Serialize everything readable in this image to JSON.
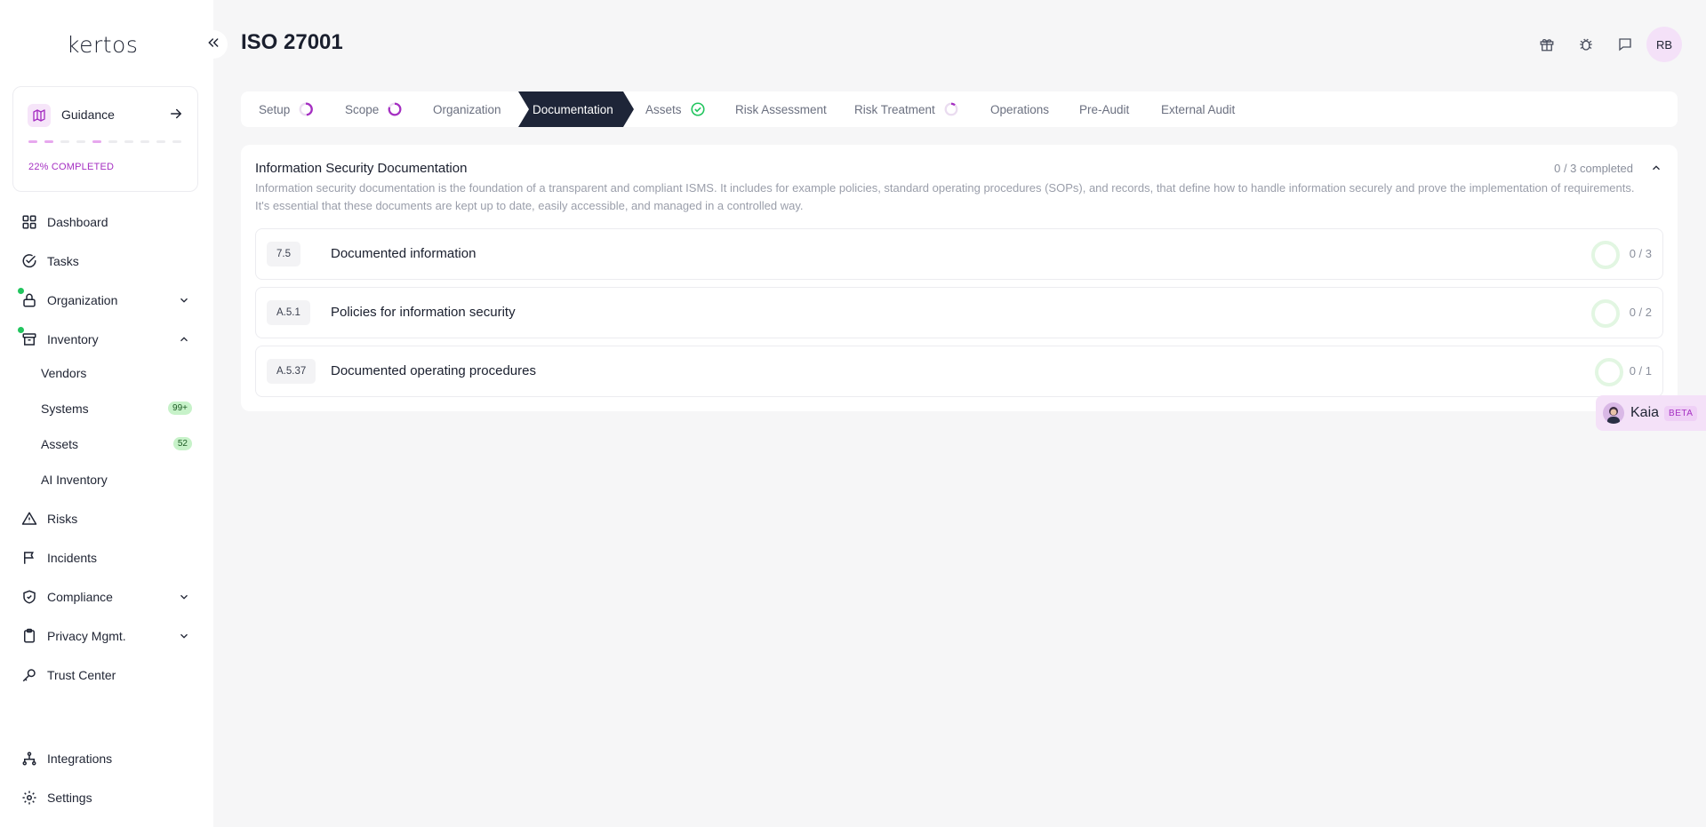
{
  "app": {
    "logo": "kertos",
    "collapse_icon": "double-chevron-left-icon"
  },
  "guidance": {
    "label": "Guidance",
    "progress_text": "22% COMPLETED",
    "progress_fraction": 0.22,
    "steps_total": 10,
    "steps_done": [
      0,
      1,
      4
    ]
  },
  "sidebar": {
    "items": [
      {
        "label": "Dashboard",
        "icon": "grid-icon"
      },
      {
        "label": "Tasks",
        "icon": "check-circle-icon"
      },
      {
        "label": "Organization",
        "icon": "lock-icon",
        "expand": "chevron-down-icon"
      },
      {
        "label": "Inventory",
        "icon": "archive-icon",
        "expand": "chevron-up-icon"
      },
      {
        "label": "Risks",
        "icon": "warning-icon"
      },
      {
        "label": "Incidents",
        "icon": "flag-icon"
      },
      {
        "label": "Compliance",
        "icon": "shield-check-icon",
        "expand": "chevron-down-icon"
      },
      {
        "label": "Privacy Mgmt.",
        "icon": "clipboard-icon",
        "expand": "chevron-down-icon"
      },
      {
        "label": "Trust Center",
        "icon": "key-icon"
      },
      {
        "label": "Integrations",
        "icon": "network-icon"
      },
      {
        "label": "Settings",
        "icon": "gear-icon"
      }
    ],
    "inventory_sub": [
      {
        "label": "Vendors"
      },
      {
        "label": "Systems",
        "badge": "99+"
      },
      {
        "label": "Assets",
        "badge": "52"
      },
      {
        "label": "AI Inventory"
      }
    ]
  },
  "header": {
    "title": "ISO 27001",
    "icons": [
      "gift-icon",
      "bug-icon",
      "chat-icon"
    ],
    "avatar": "RB"
  },
  "stepper": {
    "steps": [
      {
        "label": "Setup",
        "status": "in-progress"
      },
      {
        "label": "Scope",
        "status": "in-progress"
      },
      {
        "label": "Organization",
        "status": "none"
      },
      {
        "label": "Documentation",
        "status": "active"
      },
      {
        "label": "Assets",
        "status": "done"
      },
      {
        "label": "Risk Assessment",
        "status": "none"
      },
      {
        "label": "Risk Treatment",
        "status": "in-progress"
      },
      {
        "label": "Operations",
        "status": "none"
      },
      {
        "label": "Pre-Audit",
        "status": "none"
      },
      {
        "label": "External Audit",
        "status": "none"
      }
    ],
    "active_color": "#1e2538"
  },
  "section": {
    "title": "Information Security Documentation",
    "status": "0 / 3 completed",
    "description": "Information security documentation is the foundation of a transparent and compliant ISMS. It includes for example policies, standard operating procedures (SOPs), and records, that define how to handle information securely and prove the implementation of requirements. It's essential that these documents are kept up to date, easily accessible, and managed in a controlled way.",
    "requirements": [
      {
        "code": "7.5",
        "title": "Documented information",
        "count": "0 / 3"
      },
      {
        "code": "A.5.1",
        "title": "Policies for information security",
        "count": "0 / 2"
      },
      {
        "code": "A.5.37",
        "title": "Documented operating procedures",
        "count": "0 / 1"
      }
    ]
  },
  "assistant": {
    "name": "Kaia",
    "badge": "BETA"
  },
  "colors": {
    "accent": "#a52fc2",
    "success": "#22c55e",
    "dark": "#1e2538"
  }
}
